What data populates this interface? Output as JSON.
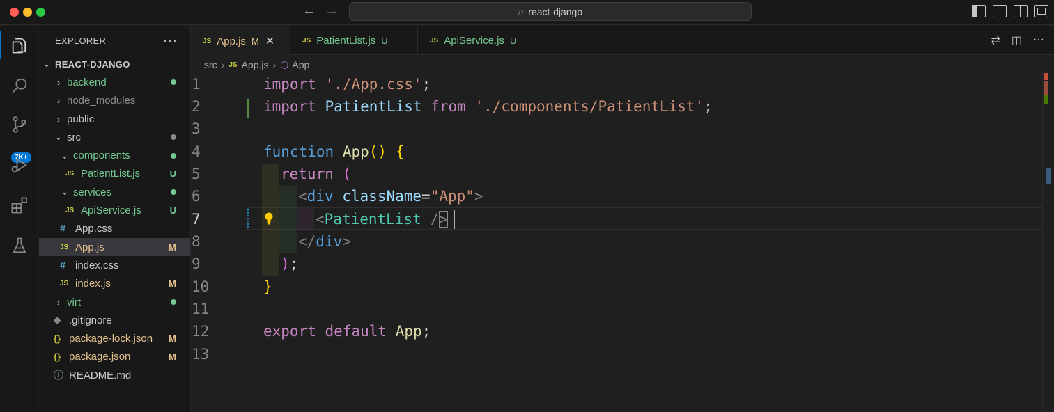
{
  "window": {
    "search_label": "react-django"
  },
  "activity_bar": {
    "items": [
      "explorer-icon",
      "search-icon",
      "source-control-icon",
      "run-debug-icon",
      "extensions-icon",
      "testing-icon"
    ],
    "scm_badge": "7K+"
  },
  "explorer": {
    "title": "EXPLORER",
    "more": "···",
    "root": "REACT-DJANGO",
    "items": [
      {
        "label": "backend",
        "status": ""
      },
      {
        "label": "node_modules",
        "status": ""
      },
      {
        "label": "public",
        "status": ""
      },
      {
        "label": "src",
        "status": ""
      },
      {
        "label": "components",
        "status": ""
      },
      {
        "label": "PatientList.js",
        "status": "U"
      },
      {
        "label": "services",
        "status": ""
      },
      {
        "label": "ApiService.js",
        "status": "U"
      },
      {
        "label": "App.css",
        "status": ""
      },
      {
        "label": "App.js",
        "status": "M"
      },
      {
        "label": "index.css",
        "status": ""
      },
      {
        "label": "index.js",
        "status": "M"
      },
      {
        "label": "virt",
        "status": ""
      },
      {
        "label": ".gitignore",
        "status": ""
      },
      {
        "label": "package-lock.json",
        "status": "M"
      },
      {
        "label": "package.json",
        "status": "M"
      },
      {
        "label": "README.md",
        "status": ""
      }
    ],
    "file_icon_js": "JS",
    "file_icon_css": "#",
    "file_icon_json": "{}"
  },
  "tabs": [
    {
      "label": "App.js",
      "status": "M",
      "icon": "JS"
    },
    {
      "label": "PatientList.js",
      "status": "U",
      "icon": "JS"
    },
    {
      "label": "ApiService.js",
      "status": "U",
      "icon": "JS"
    }
  ],
  "breadcrumb": {
    "folder": "src",
    "file": "App.js",
    "symbol": "App"
  },
  "editor": {
    "current_line": 7,
    "line_numbers": [
      "1",
      "2",
      "3",
      "4",
      "5",
      "6",
      "7",
      "8",
      "9",
      "10",
      "11",
      "12",
      "13"
    ],
    "tokens": {
      "l1": [
        "import",
        " ",
        "'./App.css'",
        ";"
      ],
      "l2": [
        "import",
        " ",
        "PatientList",
        " ",
        "from",
        " ",
        "'./components/PatientList'",
        ";"
      ],
      "l4": [
        "function",
        " ",
        "App",
        "(",
        ")",
        " ",
        "{"
      ],
      "l5": [
        "return",
        " ",
        "("
      ],
      "l6": [
        "<",
        "div",
        " ",
        "className",
        "=",
        "\"App\"",
        ">"
      ],
      "l7": [
        "<",
        "PatientList",
        " ",
        "/",
        ">"
      ],
      "l8": [
        "</",
        "div",
        ">"
      ],
      "l9": [
        ")",
        ";"
      ],
      "l10": [
        "}"
      ],
      "l12": [
        "export",
        " ",
        "default",
        " ",
        "App",
        ";"
      ]
    }
  },
  "colors": {
    "accent": "#0078d4",
    "modified": "#e2c08d",
    "untracked": "#73c991"
  }
}
